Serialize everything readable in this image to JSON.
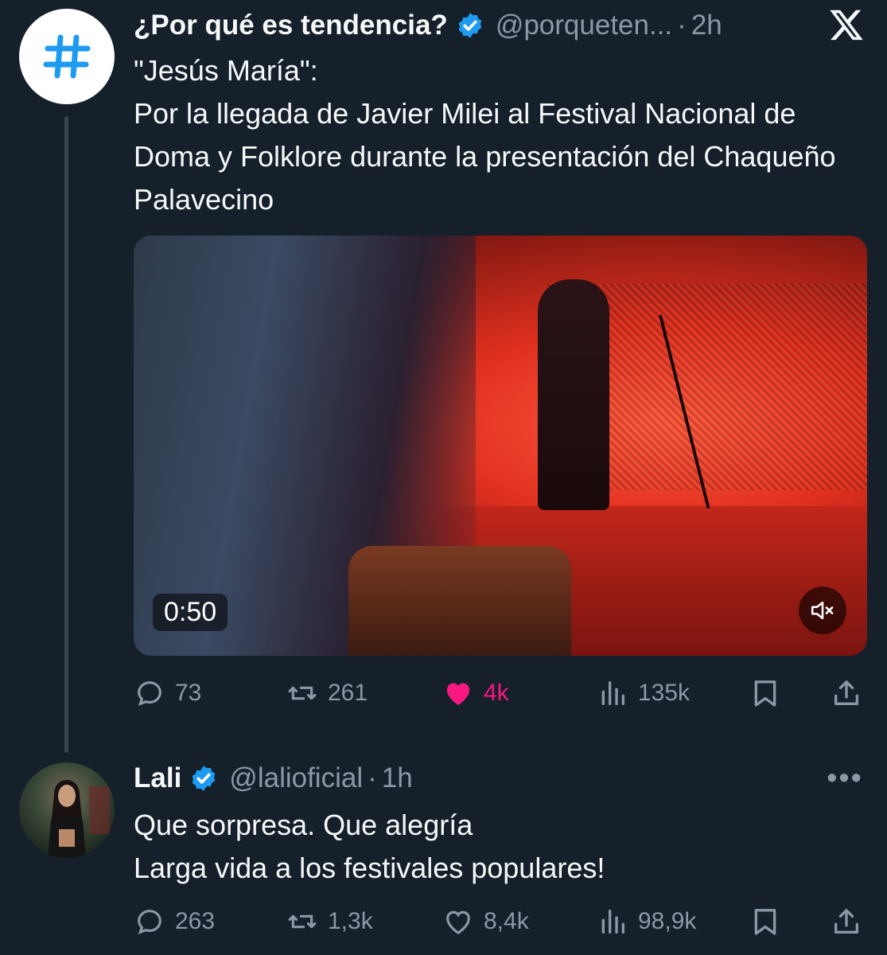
{
  "tweets": [
    {
      "author": "¿Por qué es tendencia?",
      "handle": "@porqueten...",
      "time": "2h",
      "text": "\"Jesús María\":\nPor la llegada de Javier Milei al Festival Nacional de Doma y Folklore durante la presentación del Chaqueño Palavecino",
      "video_duration": "0:50",
      "actions": {
        "replies": "73",
        "retweets": "261",
        "likes": "4k",
        "views": "135k"
      },
      "liked": true
    },
    {
      "author": "Lali",
      "handle": "@lalioficial",
      "time": "1h",
      "text": "Que sorpresa. Que alegría\nLarga vida a los festivales populares!",
      "actions": {
        "replies": "263",
        "retweets": "1,3k",
        "likes": "8,4k",
        "views": "98,9k"
      },
      "liked": false
    }
  ],
  "separator": "·",
  "colors": {
    "background": "#15202b",
    "text": "#f7f9f9",
    "secondary": "#8b98a5",
    "verified": "#1d9bf0",
    "like": "#f91880",
    "hashtag": "#1d9bf0"
  },
  "icons": [
    "x-logo-icon",
    "verified-badge-icon",
    "hashtag-icon",
    "reply-icon",
    "retweet-icon",
    "heart-icon",
    "views-icon",
    "bookmark-icon",
    "share-icon",
    "mute-icon",
    "more-icon"
  ]
}
